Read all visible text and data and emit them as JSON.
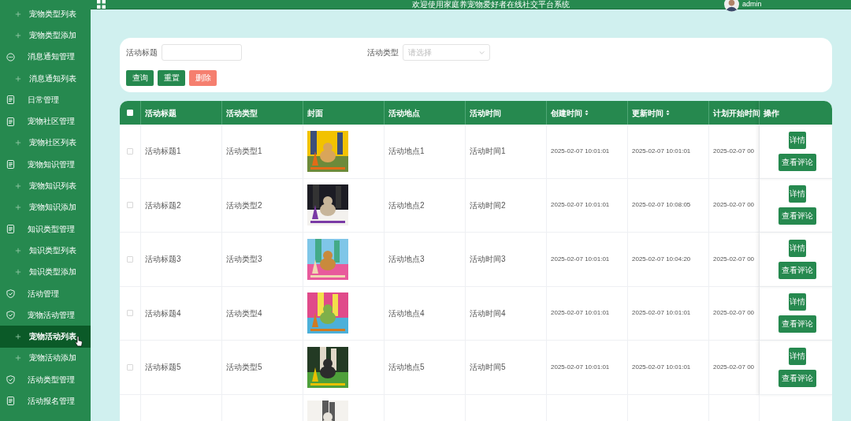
{
  "header": {
    "title": "欢迎使用家庭养宠物爱好者在线社交平台系统",
    "user": "admin"
  },
  "sidebar": {
    "items": [
      {
        "label": "宠物类型列表",
        "kind": "child",
        "selected": false
      },
      {
        "label": "宠物类型添加",
        "kind": "child",
        "selected": false
      },
      {
        "label": "消息通知管理",
        "kind": "chat",
        "selected": false
      },
      {
        "label": "消息通知列表",
        "kind": "child",
        "selected": false
      },
      {
        "label": "日常管理",
        "kind": "doc",
        "selected": false
      },
      {
        "label": "宠物社区管理",
        "kind": "doc",
        "selected": false
      },
      {
        "label": "宠物社区列表",
        "kind": "child",
        "selected": false
      },
      {
        "label": "宠物知识管理",
        "kind": "doc",
        "selected": false
      },
      {
        "label": "宠物知识列表",
        "kind": "child",
        "selected": false
      },
      {
        "label": "宠物知识添加",
        "kind": "child",
        "selected": false
      },
      {
        "label": "知识类型管理",
        "kind": "doc",
        "selected": false
      },
      {
        "label": "知识类型列表",
        "kind": "child",
        "selected": false
      },
      {
        "label": "知识类型添加",
        "kind": "child",
        "selected": false
      },
      {
        "label": "活动管理",
        "kind": "shield",
        "selected": false
      },
      {
        "label": "宠物活动管理",
        "kind": "shield",
        "selected": false
      },
      {
        "label": "宠物活动列表",
        "kind": "child",
        "selected": true
      },
      {
        "label": "宠物活动添加",
        "kind": "child",
        "selected": false
      },
      {
        "label": "活动类型管理",
        "kind": "shield",
        "selected": false
      },
      {
        "label": "活动报名管理",
        "kind": "doc",
        "selected": false
      }
    ]
  },
  "search": {
    "fields": [
      {
        "label": "活动标题",
        "kind": "text"
      },
      {
        "label": "活动类型",
        "kind": "select",
        "placeholder": "请选择"
      }
    ],
    "buttons": [
      {
        "label": "查询",
        "kind": "primary"
      },
      {
        "label": "重置",
        "kind": "primary"
      },
      {
        "label": "删除",
        "kind": "danger"
      }
    ]
  },
  "table": {
    "select_all_checked": false,
    "columns": [
      {
        "label": "活动标题"
      },
      {
        "label": "活动类型"
      },
      {
        "label": "封面"
      },
      {
        "label": "活动地点"
      },
      {
        "label": "活动时间"
      },
      {
        "label": "创建时间",
        "sortable": true
      },
      {
        "label": "更新时间",
        "sortable": true
      },
      {
        "label": "计划开始时间"
      },
      {
        "label": "操作"
      }
    ],
    "rows": [
      {
        "checked": false,
        "cells": [
          "活动标题1",
          "活动类型1",
          {
            "kind": "picture"
          },
          "活动地点1",
          "活动时间1",
          "2025-02-07 10:01:01",
          "2025-02-07 10:01:01",
          "2025-02-07 00"
        ],
        "actions": [
          "详情",
          "查看评论"
        ]
      },
      {
        "checked": false,
        "cells": [
          "活动标题2",
          "活动类型2",
          {
            "kind": "picture"
          },
          "活动地点2",
          "活动时间2",
          "2025-02-07 10:01:01",
          "2025-02-07 10:08:05",
          "2025-02-07 00"
        ],
        "actions": [
          "详情",
          "查看评论"
        ]
      },
      {
        "checked": false,
        "cells": [
          "活动标题3",
          "活动类型3",
          {
            "kind": "picture"
          },
          "活动地点3",
          "活动时间3",
          "2025-02-07 10:01:01",
          "2025-02-07 10:04:20",
          "2025-02-07 00"
        ],
        "actions": [
          "详情",
          "查看评论"
        ]
      },
      {
        "checked": false,
        "cells": [
          "活动标题4",
          "活动类型4",
          {
            "kind": "picture"
          },
          "活动地点4",
          "活动时间4",
          "2025-02-07 10:01:01",
          "2025-02-07 10:01:01",
          "2025-02-07 00"
        ],
        "actions": [
          "详情",
          "查看评论"
        ]
      },
      {
        "checked": false,
        "cells": [
          "活动标题5",
          "活动类型5",
          {
            "kind": "picture"
          },
          "活动地点5",
          "活动时间5",
          "2025-02-07 10:01:01",
          "2025-02-07 10:01:01",
          "2025-02-07 00"
        ],
        "actions": [
          "详情",
          "查看评论"
        ]
      }
    ]
  }
}
